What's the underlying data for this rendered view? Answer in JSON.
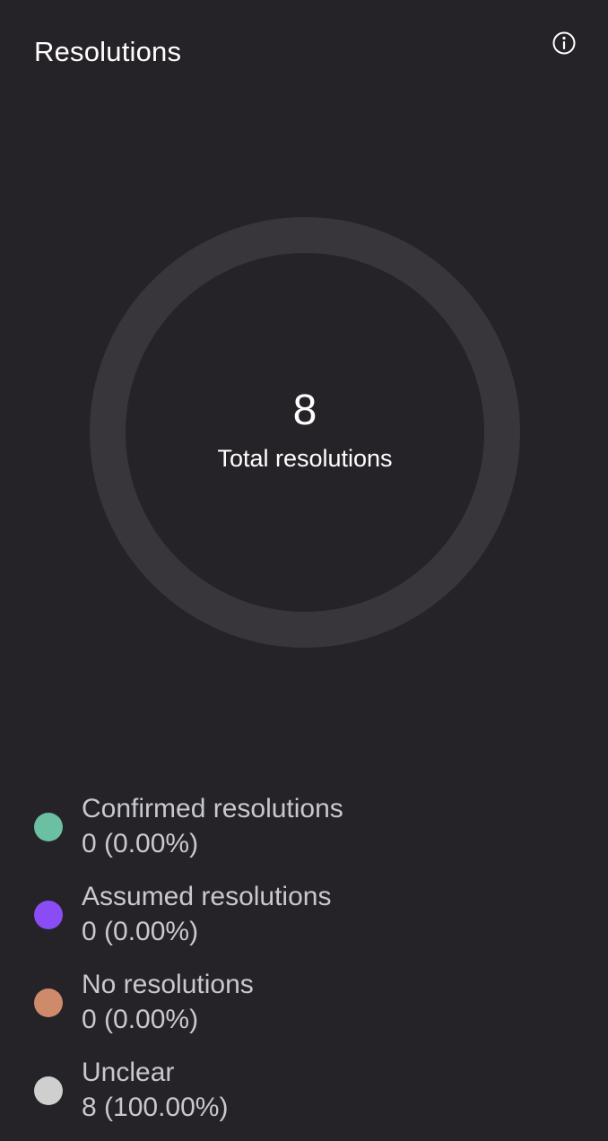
{
  "panel": {
    "title": "Resolutions",
    "info_icon": "info-circle-icon"
  },
  "chart_data": {
    "type": "pie",
    "total": {
      "value": "8",
      "label": "Total resolutions"
    },
    "ring_color": "#38363b",
    "series": [
      {
        "name": "Confirmed resolutions",
        "value": 0,
        "display": "0 (0.00%)",
        "color": "#6bbfa3"
      },
      {
        "name": "Assumed resolutions",
        "value": 0,
        "display": "0 (0.00%)",
        "color": "#8a4cf5"
      },
      {
        "name": "No resolutions",
        "value": 0,
        "display": "0 (0.00%)",
        "color": "#cf8a6c"
      },
      {
        "name": "Unclear",
        "value": 8,
        "display": "8 (100.00%)",
        "color": "#cfcfcf"
      }
    ]
  }
}
